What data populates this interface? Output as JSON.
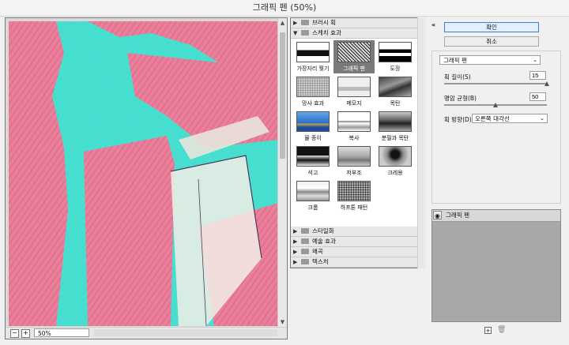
{
  "window": {
    "title": "그래픽 펜 (50%)"
  },
  "preview": {
    "zoom": "50%",
    "minus_icon": "zoom-out-icon",
    "plus_icon": "zoom-in-icon"
  },
  "browser": {
    "sections": [
      {
        "label": "브러시 획",
        "expanded": false
      },
      {
        "label": "스케치 효과",
        "expanded": true
      },
      {
        "label": "스타일화",
        "expanded": false
      },
      {
        "label": "예술 효과",
        "expanded": false
      },
      {
        "label": "왜곡",
        "expanded": false
      },
      {
        "label": "텍스처",
        "expanded": false
      }
    ],
    "filters": [
      {
        "label": "가장자리 찢기",
        "selected": false
      },
      {
        "label": "그래픽 펜",
        "selected": true
      },
      {
        "label": "도장",
        "selected": false
      },
      {
        "label": "망사 효과",
        "selected": false
      },
      {
        "label": "메모지",
        "selected": false
      },
      {
        "label": "목탄",
        "selected": false
      },
      {
        "label": "물 종이",
        "selected": false
      },
      {
        "label": "복사",
        "selected": false
      },
      {
        "label": "분필과 목탄",
        "selected": false
      },
      {
        "label": "석고",
        "selected": false
      },
      {
        "label": "저부조",
        "selected": false
      },
      {
        "label": "크레용",
        "selected": false
      },
      {
        "label": "크롬",
        "selected": false
      },
      {
        "label": "하프톤 패턴",
        "selected": false
      }
    ]
  },
  "controls": {
    "ok_label": "확인",
    "cancel_label": "취소",
    "filter_select": "그래픽 펜",
    "stroke_length_label": "획 길이(S)",
    "stroke_length_value": "15",
    "stroke_length_fraction": 1.0,
    "balance_label": "명암 균형(B)",
    "balance_value": "50",
    "balance_fraction": 0.5,
    "direction_label": "획 방향(D):",
    "direction_value": "오른쪽 대각선"
  },
  "layers": {
    "items": [
      {
        "label": "그래픽 펜"
      }
    ]
  },
  "colors": {
    "preview_pink": "#f07a97",
    "preview_cyan": "#3fe3d2",
    "ok_border": "#3c7fd0"
  }
}
